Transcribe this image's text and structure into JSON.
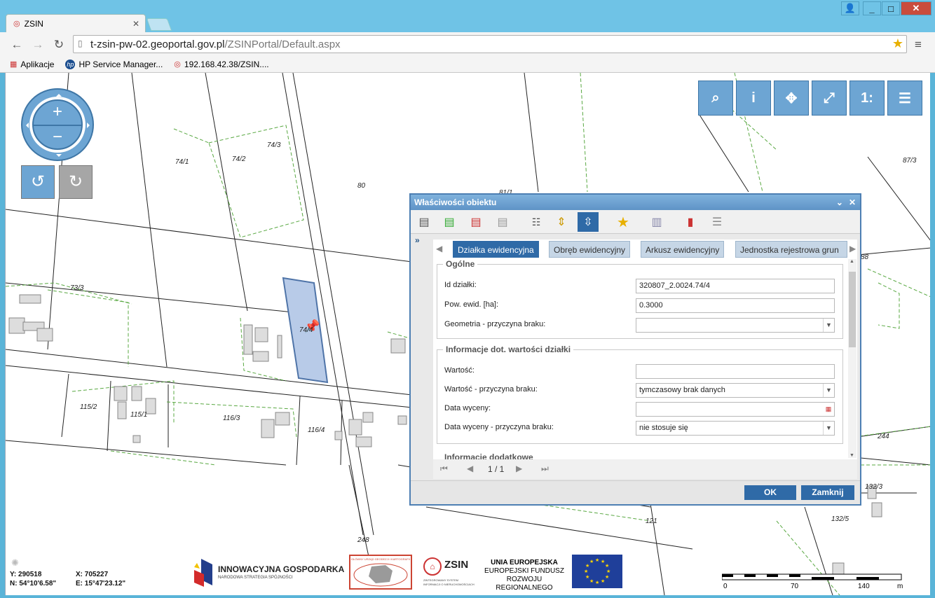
{
  "browser": {
    "tab_title": "ZSIN",
    "url_host": "t-zsin-pw-02.geoportal.gov.pl",
    "url_path": "/ZSINPortal/Default.aspx",
    "bookmarks": [
      {
        "label": "Aplikacje",
        "icon": "apps-grid-icon"
      },
      {
        "label": "HP Service Manager...",
        "icon": "hp-logo-icon"
      },
      {
        "label": "192.168.42.38/ZSIN....",
        "icon": "zsin-logo-icon"
      }
    ]
  },
  "map": {
    "plot_labels": [
      {
        "text": "74/1"
      },
      {
        "text": "74/2"
      },
      {
        "text": "74/3"
      },
      {
        "text": "80"
      },
      {
        "text": "81/1"
      },
      {
        "text": "73/3"
      },
      {
        "text": "74/4"
      },
      {
        "text": "115/2"
      },
      {
        "text": "115/1"
      },
      {
        "text": "116/3"
      },
      {
        "text": "116/4"
      },
      {
        "text": "87/3"
      },
      {
        "text": "88"
      },
      {
        "text": "244"
      },
      {
        "text": "132/3"
      },
      {
        "text": "132/5"
      },
      {
        "text": "121"
      },
      {
        "text": "248"
      }
    ],
    "tools": [
      {
        "name": "search-tool-button",
        "glyph": "🔍"
      },
      {
        "name": "info-tool-button",
        "glyph": "i"
      },
      {
        "name": "full-extent-button",
        "glyph": "⤧"
      },
      {
        "name": "fullscreen-button",
        "glyph": "⤢"
      },
      {
        "name": "scale-button",
        "glyph": "1:"
      },
      {
        "name": "menu-button",
        "glyph": "☰"
      }
    ],
    "coords": {
      "y_label": "Y: 290518",
      "x_label": "X: 705227",
      "n_label": "N: 54°10'6.58\"",
      "e_label": "E: 15°47'23.12\""
    },
    "scale": {
      "ticks": [
        "0",
        "70",
        "140"
      ],
      "unit": "m"
    },
    "logos": {
      "innowacyjna_title": "INNOWACYJNA GOSPODARKA",
      "innowacyjna_sub": "NARODOWA STRATEGIA SPÓJNOŚCI",
      "gugik": "GŁÓWNY URZĄD GEODEZJI I KARTOGRAFII",
      "zsin_title": "ZSIN",
      "zsin_sub1": "ZINTEGROWANY SYSTEM",
      "zsin_sub2": "INFORMACJI O NIERUCHOMOŚCIACH",
      "ue_line1": "UNIA EUROPEJSKA",
      "ue_line2": "EUROPEJSKI FUNDUSZ",
      "ue_line3": "ROZWOJU REGIONALNEGO"
    }
  },
  "dialog": {
    "title": "Właściwości obiektu",
    "tabs": [
      "Działka ewidencyjna",
      "Obręb ewidencyjny",
      "Arkusz ewidencyjny",
      "Jednostka rejestrowa grun"
    ],
    "sections": {
      "general": {
        "legend": "Ogólne",
        "fields": [
          {
            "label": "Id działki:",
            "value": "320807_2.0024.74/4"
          },
          {
            "label": "Pow. ewid. [ha]:",
            "value": "0.3000"
          },
          {
            "label": "Geometria - przyczyna braku:",
            "value": ""
          }
        ]
      },
      "value_info": {
        "legend": "Informacje dot. wartości działki",
        "fields": [
          {
            "label": "Wartość:",
            "value": ""
          },
          {
            "label": "Wartość - przyczyna braku:",
            "value": "tymczasowy brak danych"
          },
          {
            "label": "Data wyceny:",
            "value": ""
          },
          {
            "label": "Data wyceny - przyczyna braku:",
            "value": "nie stosuje się"
          }
        ]
      },
      "next_legend": "Informacje dodatkowe"
    },
    "pager": {
      "text": "1 / 1"
    },
    "buttons": {
      "ok": "OK",
      "close": "Zamknij"
    }
  }
}
